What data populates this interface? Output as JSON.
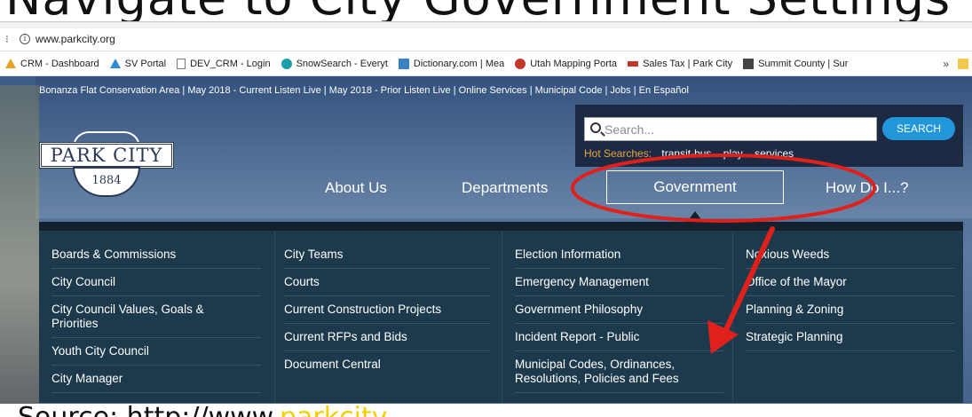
{
  "slide": {
    "top_caption": "Navigate to City Government Settings",
    "bottom_caption_prefix": "Source: http://www.",
    "bottom_caption_highlight": "parkcity"
  },
  "browser": {
    "url": "www.parkcity.org",
    "bookmarks": [
      {
        "label": "CRM - Dashboard",
        "icon": "triangle-icon-orange"
      },
      {
        "label": "SV Portal",
        "icon": "triangle-icon-blue"
      },
      {
        "label": "DEV_CRM - Login",
        "icon": "page-icon"
      },
      {
        "label": "SnowSearch - Everyt",
        "icon": "snow-icon"
      },
      {
        "label": "Dictionary.com | Mea",
        "icon": "dictionary-icon"
      },
      {
        "label": "Utah Mapping Porta",
        "icon": "utah-icon"
      },
      {
        "label": "Sales Tax | Park City",
        "icon": "tax-icon"
      },
      {
        "label": "Summit County | Sur",
        "icon": "summit-icon"
      }
    ],
    "more": "»"
  },
  "site": {
    "utility_links": "Bonanza Flat Conservation Area | May 2018 - Current Listen Live | May 2018 - Prior Listen Live | Online Services | Municipal Code | Jobs | En Español",
    "search": {
      "placeholder": "Search...",
      "button": "SEARCH",
      "hot_label": "Hot Searches:",
      "hot_terms": [
        "transit-bus",
        "play",
        "services"
      ]
    },
    "logo": {
      "name": "PARK CITY",
      "year": "1884"
    },
    "nav": {
      "about": "About Us",
      "departments": "Departments",
      "government": "Government",
      "how": "How Do I...?"
    },
    "menu": {
      "col1": [
        "Boards & Commissions",
        "City Council",
        "City Council Values, Goals & Priorities",
        "Youth City Council",
        "City Manager"
      ],
      "col2": [
        "City Teams",
        "Courts",
        "Current Construction Projects",
        "Current RFPs and Bids",
        "Document Central"
      ],
      "col3": [
        "Election Information",
        "Emergency Management",
        "Government Philosophy",
        "Incident Report - Public",
        "Municipal Codes, Ordinances, Resolutions, Policies and Fees"
      ],
      "col4": [
        "Noxious Weeds",
        "Office of the Mayor",
        "Planning & Zoning",
        "Strategic Planning"
      ]
    }
  },
  "annotation_color": "#e0201b"
}
